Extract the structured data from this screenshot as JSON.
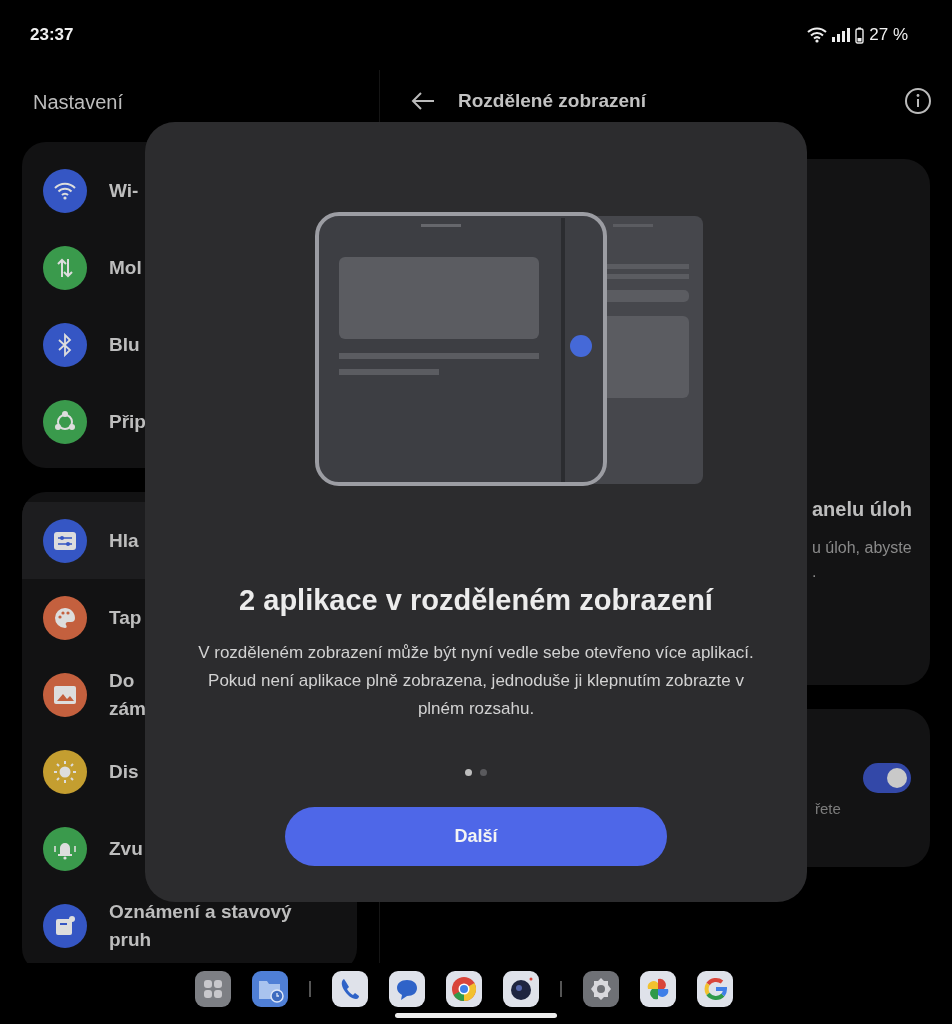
{
  "status_bar": {
    "time": "23:37",
    "battery": "27 %"
  },
  "settings_pane": {
    "title": "Nastavení",
    "groups": [
      {
        "items": [
          {
            "kind": "wifi",
            "lines": [
              "Wi-"
            ],
            "color": "#3556c4",
            "selected": false
          },
          {
            "kind": "data",
            "lines": [
              "Mol"
            ],
            "color": "#3a9a4c",
            "selected": false
          },
          {
            "kind": "bluetooth",
            "lines": [
              "Blu"
            ],
            "color": "#3556c4",
            "selected": false
          },
          {
            "kind": "share",
            "lines": [
              "Přip"
            ],
            "color": "#3a9a4c",
            "selected": false
          }
        ]
      },
      {
        "items": [
          {
            "kind": "sliders",
            "lines": [
              "Hla"
            ],
            "color": "#3556c4",
            "selected": true
          },
          {
            "kind": "palette",
            "lines": [
              "Tap"
            ],
            "color": "#c4603e",
            "selected": false
          },
          {
            "kind": "image",
            "lines": [
              "Do",
              "zám"
            ],
            "color": "#c4603e",
            "selected": false
          },
          {
            "kind": "sun",
            "lines": [
              "Dis"
            ],
            "color": "#c49e30",
            "selected": false
          },
          {
            "kind": "bell",
            "lines": [
              "Zvu"
            ],
            "color": "#3a9a4c",
            "selected": false
          },
          {
            "kind": "note",
            "lines": [
              "Oznámení a stavový",
              "pruh"
            ],
            "color": "#3556c4",
            "selected": false
          }
        ]
      }
    ]
  },
  "detail_pane": {
    "title": "Rozdělené zobrazení",
    "card": {
      "heading": "anelu úloh",
      "lines": [
        "u úloh, abyste",
        "."
      ]
    },
    "toggle_card": {
      "text": "řete",
      "on": true
    }
  },
  "dialog": {
    "title": "2 aplikace v rozděleném zobrazení",
    "body": "V rozděleném zobrazení může být nyní vedle sebe otevřeno více aplikací. Pokud není aplikace plně zobrazena, jednoduše ji klepnutím zobrazte v plném rozsahu.",
    "pages": [
      {
        "selected": true
      },
      {
        "selected": false
      }
    ],
    "button": "Další"
  }
}
